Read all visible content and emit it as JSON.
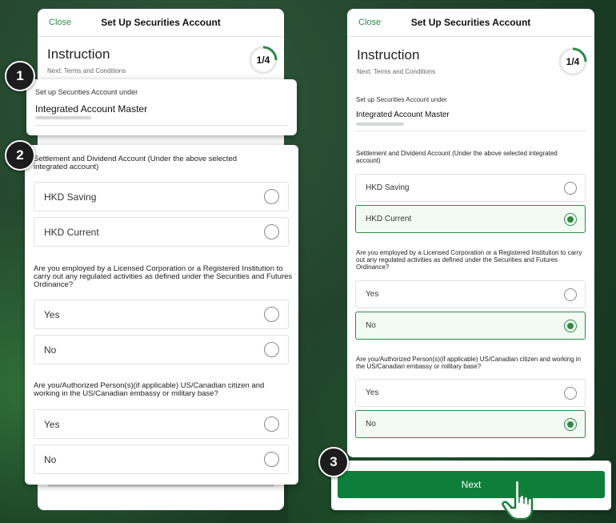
{
  "screen_title": "Set Up Securities Account",
  "close_label": "Close",
  "instruction": {
    "title": "Instruction",
    "next": "Next: Terms and Conditions",
    "progress_label": "1/4",
    "progress_fraction": 0.25
  },
  "account": {
    "under_label": "Set up Securities Account under",
    "name": "Integrated Account Master"
  },
  "settlement": {
    "question": "Settlement and Dividend Account (Under the above selected integrated account)",
    "options": [
      "HKD Saving",
      "HKD Current"
    ],
    "selected": "HKD Current"
  },
  "employed": {
    "question": "Are you employed by a Licensed Corporation or a Registered Institution to carry out any regulated activities as defined under the Securities and Futures Ordinance?",
    "options": [
      "Yes",
      "No"
    ],
    "selected": "No"
  },
  "us_citizen": {
    "question": "Are you/Authorized Person(s)(if applicable) US/Canadian citizen and working in the US/Canadian embassy or military base?",
    "options": [
      "Yes",
      "No"
    ],
    "selected": "No"
  },
  "next_label": "Next",
  "badges": [
    "1",
    "2",
    "3"
  ],
  "colors": {
    "accent": "#2e8b45",
    "button": "#0e7f3a"
  }
}
